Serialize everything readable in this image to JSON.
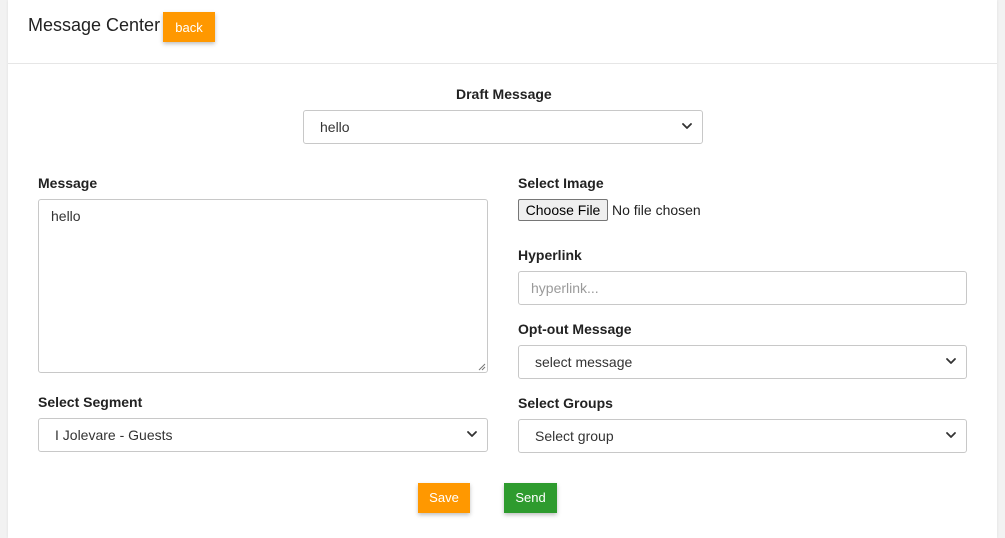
{
  "header": {
    "title": "Message Center",
    "back_label": "back"
  },
  "draft": {
    "label": "Draft Message",
    "selected": "hello"
  },
  "message": {
    "label": "Message",
    "value": "hello"
  },
  "image": {
    "label": "Select Image",
    "button_label": "Choose File",
    "status": "No file chosen"
  },
  "hyperlink": {
    "label": "Hyperlink",
    "placeholder": "hyperlink..."
  },
  "optout": {
    "label": "Opt-out Message",
    "selected": "select message"
  },
  "segment": {
    "label": "Select Segment",
    "selected": "I Jolevare - Guests"
  },
  "groups": {
    "label": "Select Groups",
    "selected": "Select group"
  },
  "actions": {
    "save_label": "Save",
    "send_label": "Send"
  },
  "colors": {
    "accent_orange": "#ff9800",
    "send_green": "#2e9b2e"
  },
  "icons": {
    "select_arrow": "chevron-down-icon",
    "resize": "resize-grip-icon"
  }
}
